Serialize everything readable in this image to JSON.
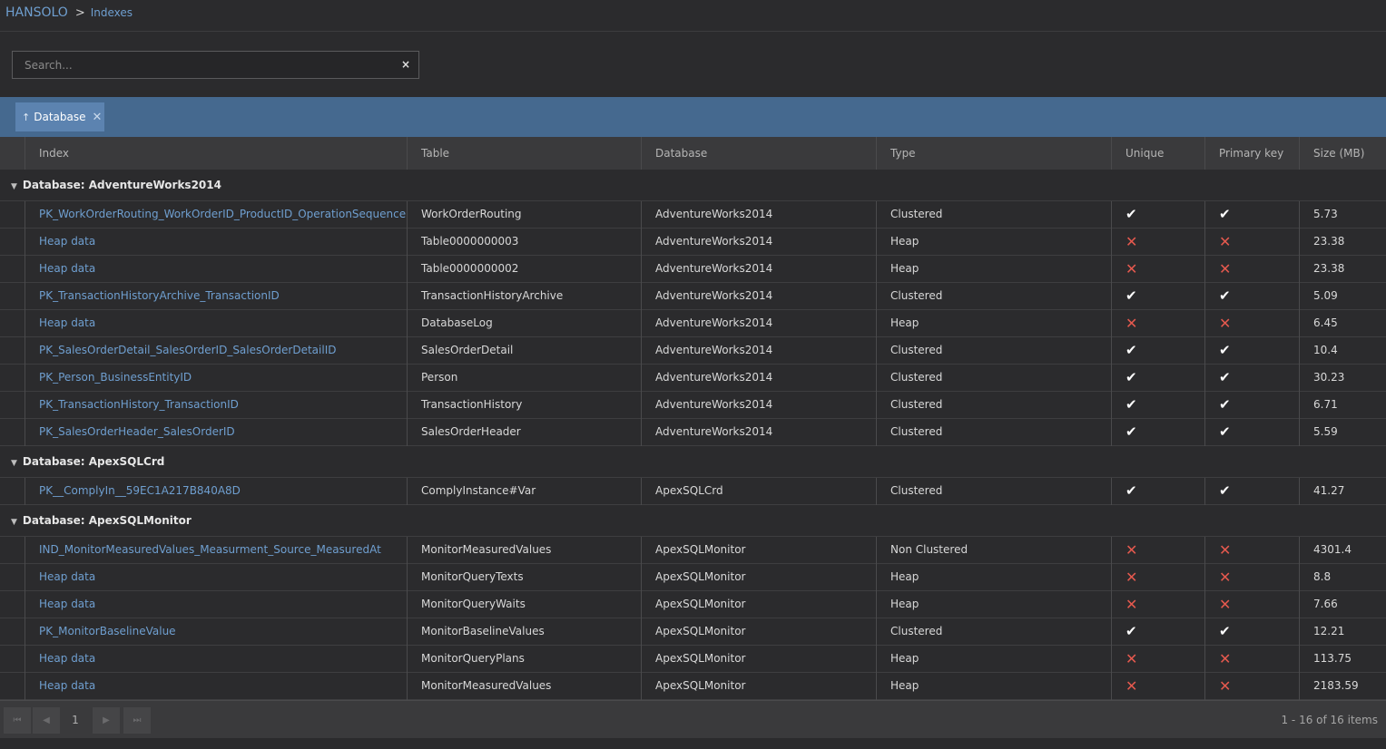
{
  "breadcrumb": {
    "root": "HANSOLO",
    "separator": ">",
    "current": "Indexes"
  },
  "search": {
    "placeholder": "Search...",
    "value": "",
    "clear_label": "×"
  },
  "grouping": {
    "chip_label": "Database",
    "chip_arrow": "↑",
    "chip_remove": "✕"
  },
  "columns": [
    "Index",
    "Table",
    "Database",
    "Type",
    "Unique",
    "Primary key",
    "Size (MB)"
  ],
  "groups": [
    {
      "label": "Database: AdventureWorks2014",
      "rows": [
        {
          "index": "PK_WorkOrderRouting_WorkOrderID_ProductID_OperationSequence",
          "table": "WorkOrderRouting",
          "database": "AdventureWorks2014",
          "type": "Clustered",
          "unique": true,
          "pk": true,
          "size": "5.73"
        },
        {
          "index": "Heap data",
          "table": "Table0000000003",
          "database": "AdventureWorks2014",
          "type": "Heap",
          "unique": false,
          "pk": false,
          "size": "23.38"
        },
        {
          "index": "Heap data",
          "table": "Table0000000002",
          "database": "AdventureWorks2014",
          "type": "Heap",
          "unique": false,
          "pk": false,
          "size": "23.38"
        },
        {
          "index": "PK_TransactionHistoryArchive_TransactionID",
          "table": "TransactionHistoryArchive",
          "database": "AdventureWorks2014",
          "type": "Clustered",
          "unique": true,
          "pk": true,
          "size": "5.09"
        },
        {
          "index": "Heap data",
          "table": "DatabaseLog",
          "database": "AdventureWorks2014",
          "type": "Heap",
          "unique": false,
          "pk": false,
          "size": "6.45"
        },
        {
          "index": "PK_SalesOrderDetail_SalesOrderID_SalesOrderDetailID",
          "table": "SalesOrderDetail",
          "database": "AdventureWorks2014",
          "type": "Clustered",
          "unique": true,
          "pk": true,
          "size": "10.4"
        },
        {
          "index": "PK_Person_BusinessEntityID",
          "table": "Person",
          "database": "AdventureWorks2014",
          "type": "Clustered",
          "unique": true,
          "pk": true,
          "size": "30.23"
        },
        {
          "index": "PK_TransactionHistory_TransactionID",
          "table": "TransactionHistory",
          "database": "AdventureWorks2014",
          "type": "Clustered",
          "unique": true,
          "pk": true,
          "size": "6.71"
        },
        {
          "index": "PK_SalesOrderHeader_SalesOrderID",
          "table": "SalesOrderHeader",
          "database": "AdventureWorks2014",
          "type": "Clustered",
          "unique": true,
          "pk": true,
          "size": "5.59"
        }
      ]
    },
    {
      "label": "Database: ApexSQLCrd",
      "rows": [
        {
          "index": "PK__ComplyIn__59EC1A217B840A8D",
          "table": "ComplyInstance#Var",
          "database": "ApexSQLCrd",
          "type": "Clustered",
          "unique": true,
          "pk": true,
          "size": "41.27"
        }
      ]
    },
    {
      "label": "Database: ApexSQLMonitor",
      "rows": [
        {
          "index": "IND_MonitorMeasuredValues_Measurment_Source_MeasuredAt",
          "table": "MonitorMeasuredValues",
          "database": "ApexSQLMonitor",
          "type": "Non Clustered",
          "unique": false,
          "pk": false,
          "size": "4301.4"
        },
        {
          "index": "Heap data",
          "table": "MonitorQueryTexts",
          "database": "ApexSQLMonitor",
          "type": "Heap",
          "unique": false,
          "pk": false,
          "size": "8.8"
        },
        {
          "index": "Heap data",
          "table": "MonitorQueryWaits",
          "database": "ApexSQLMonitor",
          "type": "Heap",
          "unique": false,
          "pk": false,
          "size": "7.66"
        },
        {
          "index": "PK_MonitorBaselineValue",
          "table": "MonitorBaselineValues",
          "database": "ApexSQLMonitor",
          "type": "Clustered",
          "unique": true,
          "pk": true,
          "size": "12.21"
        },
        {
          "index": "Heap data",
          "table": "MonitorQueryPlans",
          "database": "ApexSQLMonitor",
          "type": "Heap",
          "unique": false,
          "pk": false,
          "size": "113.75"
        },
        {
          "index": "Heap data",
          "table": "MonitorMeasuredValues",
          "database": "ApexSQLMonitor",
          "type": "Heap",
          "unique": false,
          "pk": false,
          "size": "2183.59"
        }
      ]
    }
  ],
  "icons": {
    "check": "✔",
    "cross": "✕",
    "collapse": "▼"
  },
  "pager": {
    "first": "⏮",
    "prev": "◀",
    "page": "1",
    "next": "▶",
    "last": "⏭",
    "info": "1 - 16 of 16 items"
  },
  "colors": {
    "link": "#6f9fd0",
    "group_bar": "#45698f",
    "chip": "#5c83b0",
    "cross": "#e5594e"
  }
}
